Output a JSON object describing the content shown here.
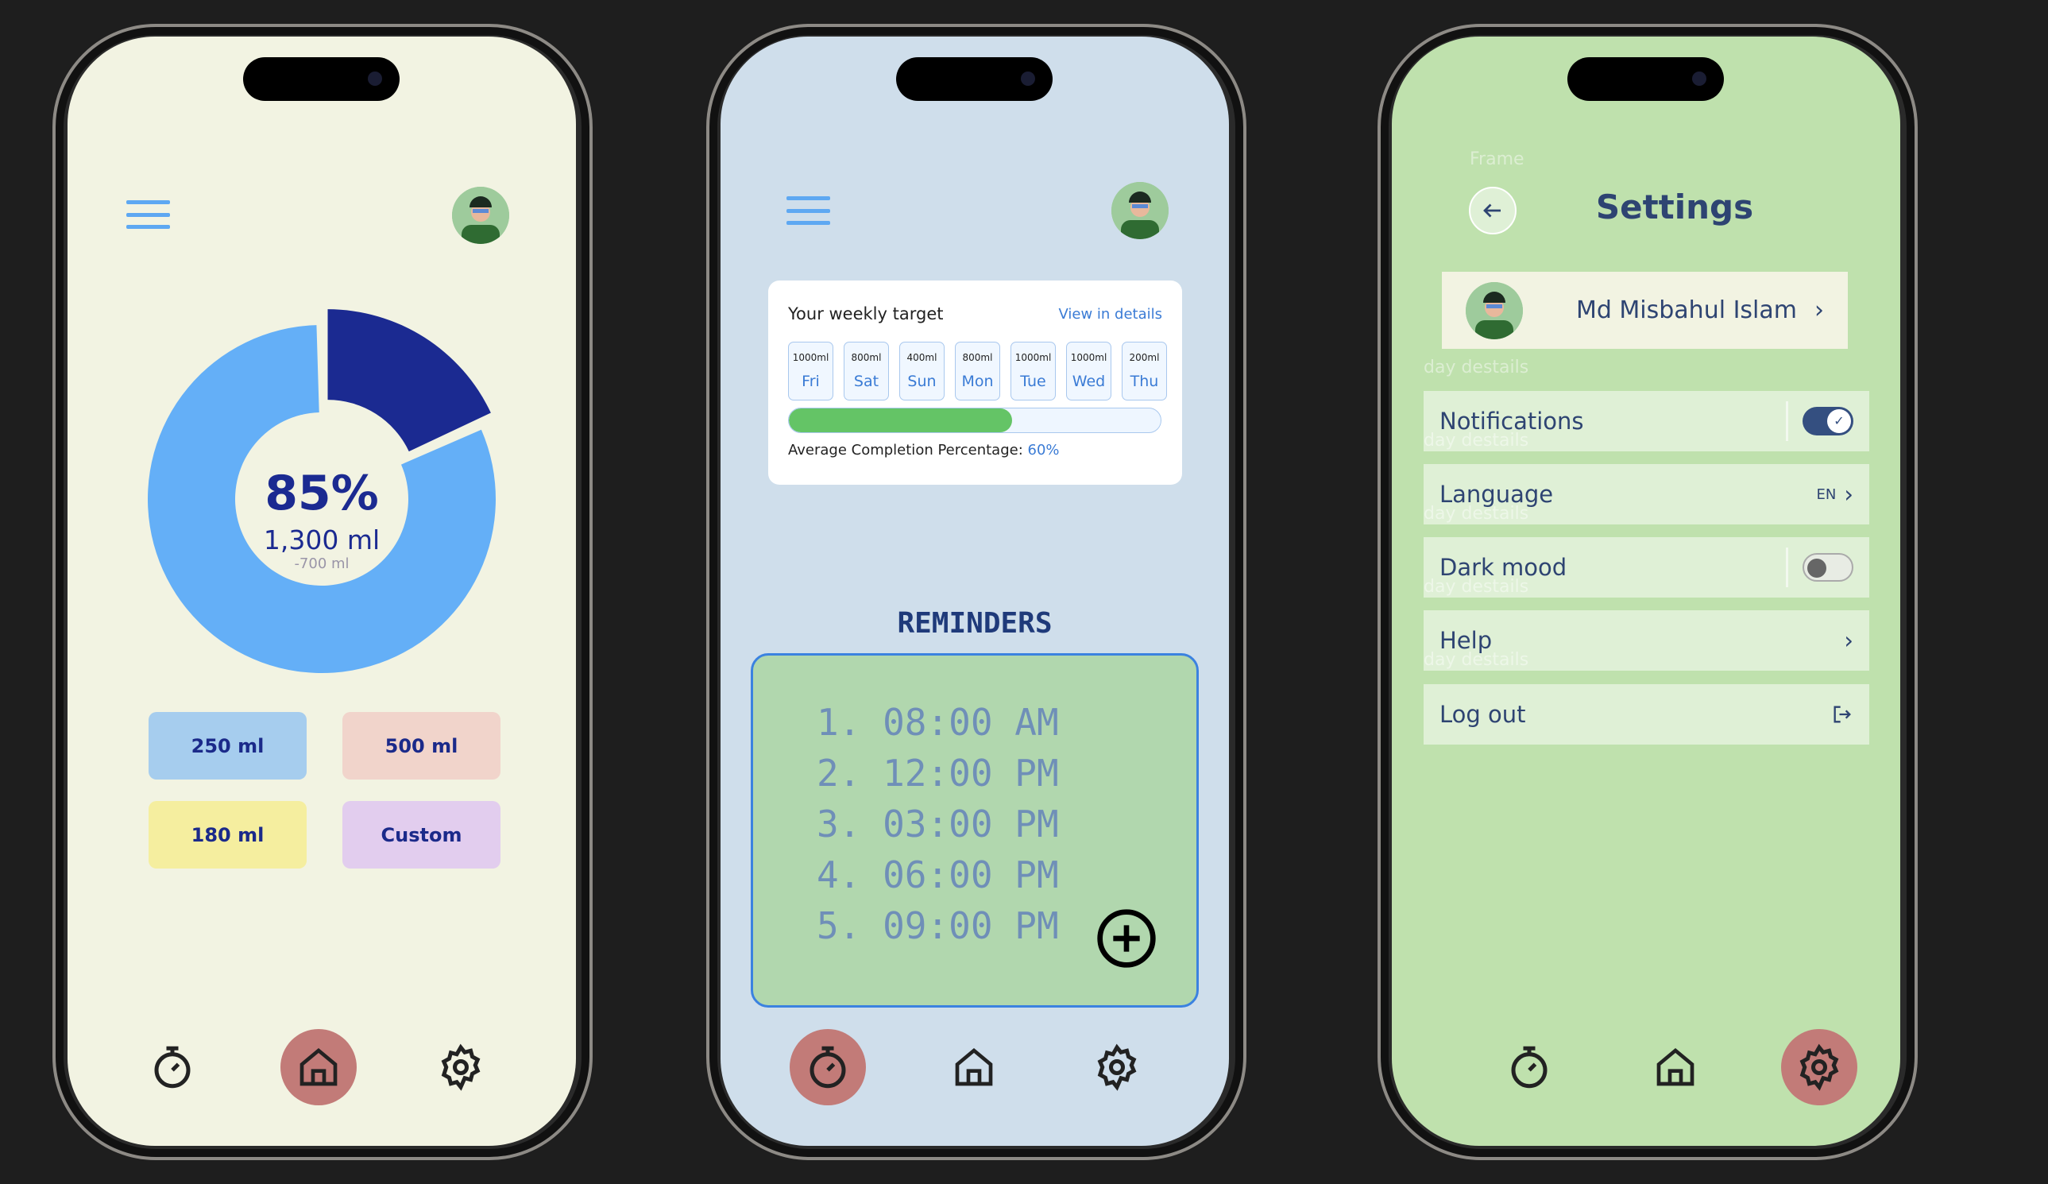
{
  "home": {
    "percent": "85%",
    "amount": "1,300 ml",
    "remaining": "-700 ml",
    "progress_fraction": 0.18,
    "quick_add": [
      "250 ml",
      "500 ml",
      "180 ml",
      "Custom"
    ],
    "colors": {
      "bg": "#f2f3e2",
      "ring": "#64aff7",
      "segment": "#1b2a91",
      "accent": "#c27b78"
    }
  },
  "reminders_screen": {
    "card": {
      "title": "Your weekly target",
      "link": "View in details",
      "days": [
        {
          "ml": "1000ml",
          "day": "Fri"
        },
        {
          "ml": "800ml",
          "day": "Sat"
        },
        {
          "ml": "400ml",
          "day": "Sun"
        },
        {
          "ml": "800ml",
          "day": "Mon"
        },
        {
          "ml": "1000ml",
          "day": "Tue"
        },
        {
          "ml": "1000ml",
          "day": "Wed"
        },
        {
          "ml": "200ml",
          "day": "Thu"
        }
      ],
      "avg_label": "Average Completion Percentage:",
      "avg_value": "60%",
      "avg_percent": 60
    },
    "heading": "REMINDERS",
    "items": [
      "1. 08:00 AM",
      "2. 12:00 PM",
      "3. 03:00 PM",
      "4. 06:00 PM",
      "5. 09:00 PM"
    ]
  },
  "settings": {
    "frame_label": "Frame",
    "title": "Settings",
    "user_name": "Md Misbahul Islam",
    "ghost_label": "day destails",
    "rows": [
      {
        "label": "Notifications",
        "toggle": true
      },
      {
        "label": "Language",
        "value": "EN"
      },
      {
        "label": "Dark mood",
        "toggle": false
      },
      {
        "label": "Help"
      },
      {
        "label": "Log out"
      }
    ]
  }
}
